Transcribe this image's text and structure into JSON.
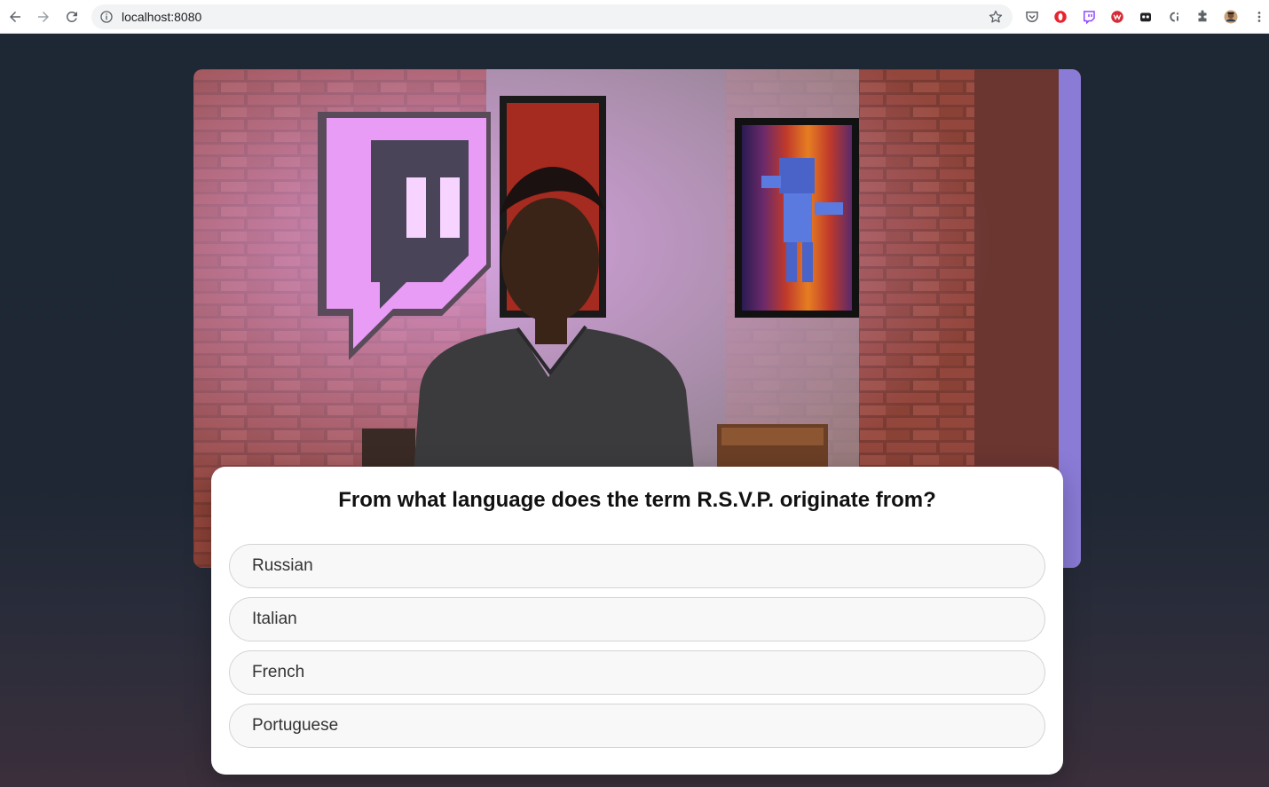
{
  "browser": {
    "url": "localhost:8080",
    "nav_icons": [
      "back-arrow-icon",
      "forward-arrow-icon",
      "reload-icon"
    ],
    "extensions": [
      "pocket-icon",
      "opera-icon",
      "twitch-icon",
      "wappalyzer-icon",
      "eyes-extension-icon",
      "cj-extension-icon",
      "puzzle-extensions-icon",
      "profile-avatar",
      "more-menu-icon"
    ]
  },
  "video": {
    "description_icon": "video-frame"
  },
  "quiz": {
    "question": "From what language does the term R.S.V.P. originate from?",
    "answers": [
      "Russian",
      "Italian",
      "French",
      "Portuguese"
    ]
  },
  "colors": {
    "page_background": "#1e2734",
    "card_background": "#ffffff",
    "answer_background": "#f8f8f8",
    "answer_border": "#d4d4d4",
    "twitch_purple": "#9146ff"
  }
}
